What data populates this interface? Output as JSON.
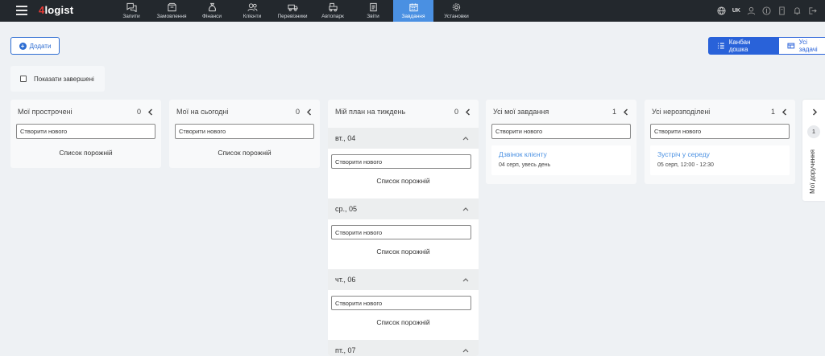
{
  "app": {
    "logo_prefix": "4",
    "logo_text": "logist"
  },
  "nav": {
    "items": [
      {
        "label": "Запити",
        "icon": "chat-icon"
      },
      {
        "label": "Замовлення",
        "icon": "box-icon"
      },
      {
        "label": "Фінанси",
        "icon": "money-bag-icon"
      },
      {
        "label": "Клієнти",
        "icon": "users-icon"
      },
      {
        "label": "Перевізники",
        "icon": "truck-icon"
      },
      {
        "label": "Автопарк",
        "icon": "vehicle-icon"
      },
      {
        "label": "Звіти",
        "icon": "report-icon"
      },
      {
        "label": "Завдання",
        "icon": "calendar-icon",
        "active": true
      },
      {
        "label": "Установки",
        "icon": "gear-icon"
      }
    ],
    "language": "UK"
  },
  "toolbar": {
    "add_label": "Додати",
    "kanban_label": "Канбан дошка",
    "all_tasks_label": "Усі задачі",
    "show_done_label": "Показати завершені"
  },
  "columns": {
    "overdue": {
      "title": "Мої прострочені",
      "count": "0",
      "input": "Створити нового",
      "empty": "Список порожній"
    },
    "today": {
      "title": "Мої на сьогодні",
      "count": "0",
      "input": "Створити нового",
      "empty": "Список порожній"
    },
    "week": {
      "title": "Мій план на тиждень",
      "count": "0",
      "days": [
        {
          "label": "вт., 04",
          "input": "Створити нового",
          "empty": "Список порожній"
        },
        {
          "label": "ср., 05",
          "input": "Створити нового",
          "empty": "Список порожній"
        },
        {
          "label": "чт., 06",
          "input": "Створити нового",
          "empty": "Список порожній"
        },
        {
          "label": "пт., 07"
        }
      ]
    },
    "all_mine": {
      "title": "Усі мої завдання",
      "count": "1",
      "input": "Створити нового",
      "task": {
        "name": "Дзвінок клієнту",
        "when": "04 серп, увесь день"
      }
    },
    "unassigned": {
      "title": "Усі нерозподілені",
      "count": "1",
      "input": "Створити нового",
      "task": {
        "name": "Зустріч у середу",
        "when": "05 серп, 12:00 - 12:30"
      }
    }
  },
  "side_panel": {
    "count": "1",
    "label": "Мої доручення"
  },
  "colors": {
    "nav_bg": "#23282d",
    "accent": "#2962d9",
    "active_tab": "#4a90e2",
    "link": "#4a90e2",
    "logo_red": "#e53935"
  }
}
